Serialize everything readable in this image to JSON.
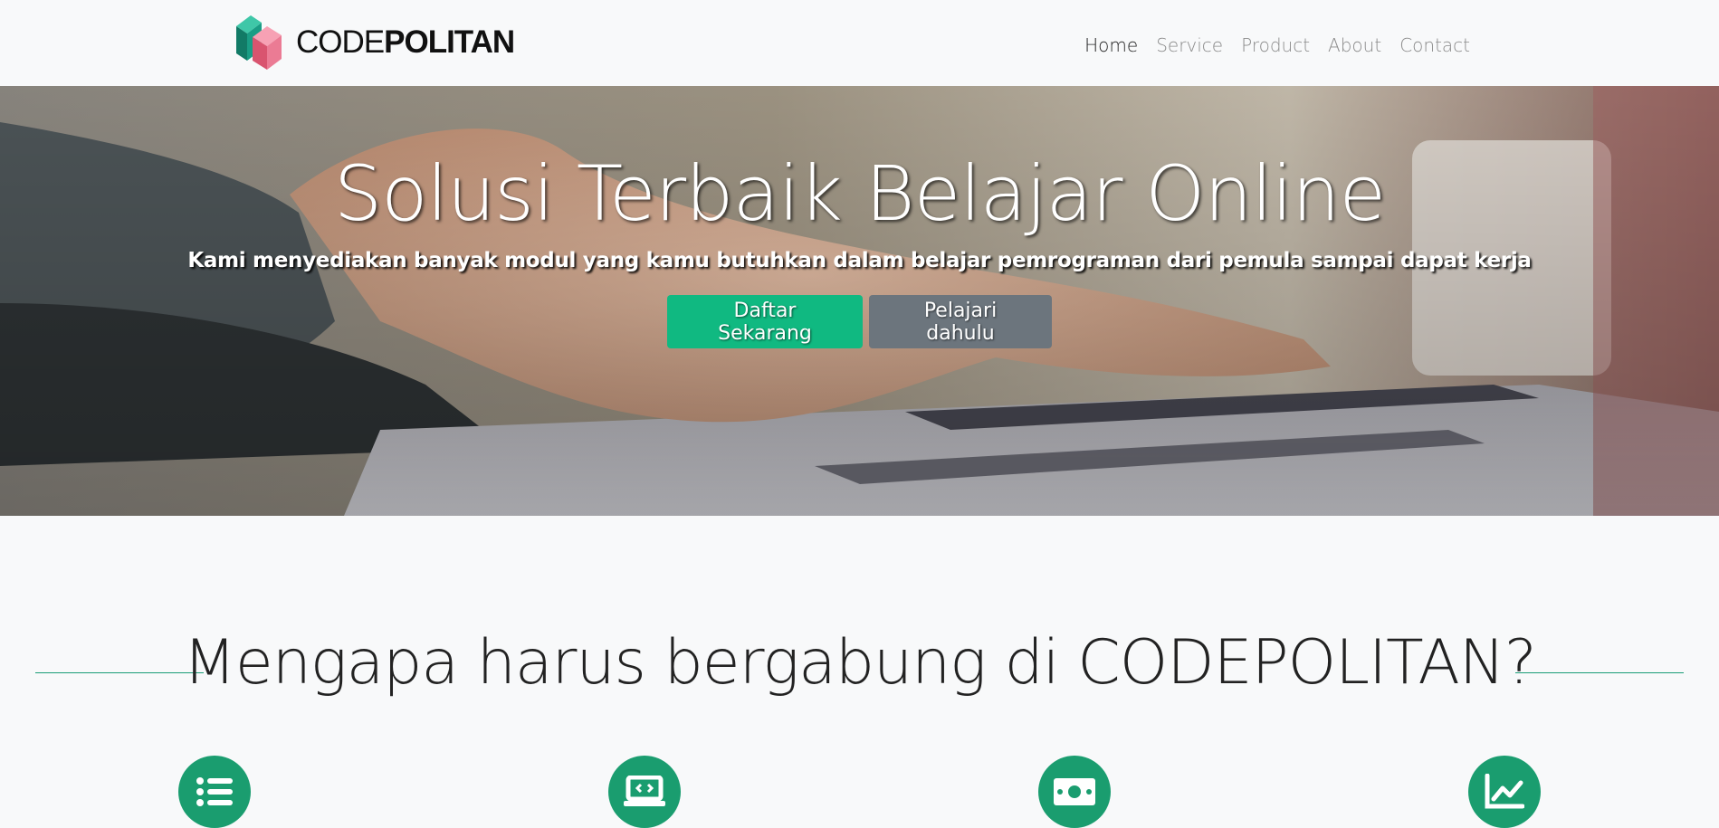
{
  "brand": {
    "name_light": "CODE",
    "name_bold": "POLITAN"
  },
  "nav": {
    "items": [
      {
        "label": "Home",
        "active": true
      },
      {
        "label": "Service",
        "active": false
      },
      {
        "label": "Product",
        "active": false
      },
      {
        "label": "About",
        "active": false
      },
      {
        "label": "Contact",
        "active": false
      }
    ]
  },
  "hero": {
    "title": "Solusi Terbaik Belajar Online",
    "subtitle": "Kami menyediakan banyak modul yang kamu butuhkan dalam belajar pemrograman dari pemula sampai dapat kerja",
    "primary_button": "Daftar Sekarang",
    "secondary_button": "Pelajari dahulu"
  },
  "why": {
    "title": "Mengapa harus bergabung di CODEPOLITAN?",
    "features": [
      {
        "icon": "list-icon"
      },
      {
        "icon": "laptop-code-icon"
      },
      {
        "icon": "money-bill-icon"
      },
      {
        "icon": "chart-line-icon"
      }
    ]
  },
  "colors": {
    "accent": "#10b981",
    "icon_bg": "#1a9d6f",
    "secondary": "#6c757d",
    "navbar_bg": "#f8f9fa"
  }
}
